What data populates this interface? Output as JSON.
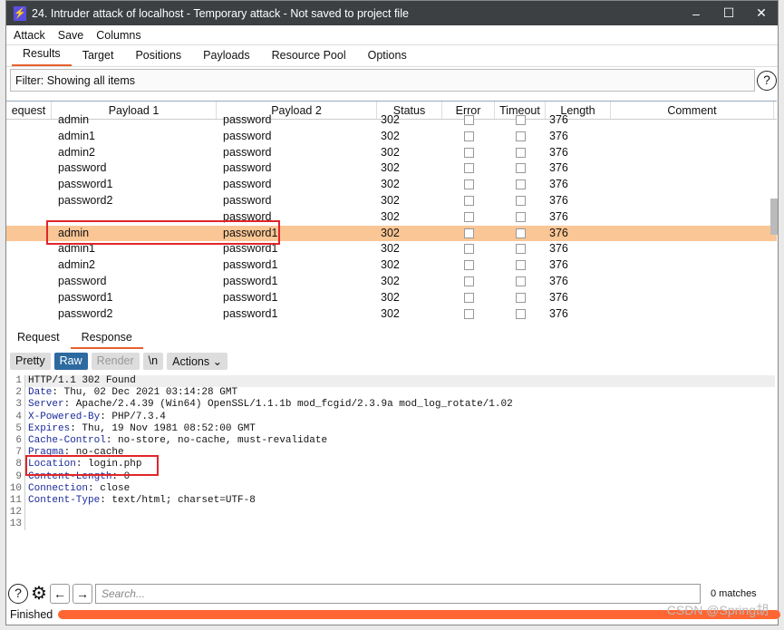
{
  "window": {
    "title": "24. Intruder attack of localhost - Temporary attack - Not saved to project file",
    "min": "–",
    "max": "☐",
    "close": "✕",
    "logo": "⚡"
  },
  "menu": [
    "Attack",
    "Save",
    "Columns"
  ],
  "tabs": [
    "Results",
    "Target",
    "Positions",
    "Payloads",
    "Resource Pool",
    "Options"
  ],
  "filter": "Filter: Showing all items",
  "help": "?",
  "columns": [
    "equest",
    "Payload 1",
    "Payload 2",
    "Status",
    "Error",
    "Timeout",
    "Length",
    "Comment"
  ],
  "rows": [
    {
      "p1": "admin",
      "p2": "password",
      "status": "302",
      "length": "376"
    },
    {
      "p1": "admin1",
      "p2": "password",
      "status": "302",
      "length": "376"
    },
    {
      "p1": "admin2",
      "p2": "password",
      "status": "302",
      "length": "376"
    },
    {
      "p1": "password",
      "p2": "password",
      "status": "302",
      "length": "376"
    },
    {
      "p1": "password1",
      "p2": "password",
      "status": "302",
      "length": "376"
    },
    {
      "p1": "password2",
      "p2": "password",
      "status": "302",
      "length": "376"
    },
    {
      "p1": "",
      "p2": "password",
      "status": "302",
      "length": "376"
    },
    {
      "p1": "admin",
      "p2": "password1",
      "status": "302",
      "length": "376",
      "selected": true
    },
    {
      "p1": "admin1",
      "p2": "password1",
      "status": "302",
      "length": "376"
    },
    {
      "p1": "admin2",
      "p2": "password1",
      "status": "302",
      "length": "376"
    },
    {
      "p1": "password",
      "p2": "password1",
      "status": "302",
      "length": "376"
    },
    {
      "p1": "password1",
      "p2": "password1",
      "status": "302",
      "length": "376"
    },
    {
      "p1": "password2",
      "p2": "password1",
      "status": "302",
      "length": "376"
    }
  ],
  "panel_tabs": [
    "Request",
    "Response"
  ],
  "toolbar": [
    "Pretty",
    "Raw",
    "Render",
    "\\n",
    "Actions ⌄"
  ],
  "response": [
    {
      "k": "",
      "v": "HTTP/1.1 302 Found"
    },
    {
      "k": "Date",
      "v": ": Thu, 02 Dec 2021 03:14:28 GMT"
    },
    {
      "k": "Server",
      "v": ": Apache/2.4.39 (Win64) OpenSSL/1.1.1b mod_fcgid/2.3.9a mod_log_rotate/1.02"
    },
    {
      "k": "X-Powered-By",
      "v": ": PHP/7.3.4"
    },
    {
      "k": "Expires",
      "v": ": Thu, 19 Nov 1981 08:52:00 GMT"
    },
    {
      "k": "Cache-Control",
      "v": ": no-store, no-cache, must-revalidate"
    },
    {
      "k": "Pragma",
      "v": ": no-cache"
    },
    {
      "k": "Location",
      "v": ": login.php"
    },
    {
      "k": "Content-Length",
      "v": ": 0"
    },
    {
      "k": "Connection",
      "v": ": close"
    },
    {
      "k": "Content-Type",
      "v": ": text/html; charset=UTF-8"
    },
    {
      "k": "",
      "v": ""
    },
    {
      "k": "",
      "v": ""
    }
  ],
  "search_placeholder": "Search...",
  "matches": "0 matches",
  "status": "Finished",
  "progress": 100,
  "watermark": "CSDN @Spring胡"
}
